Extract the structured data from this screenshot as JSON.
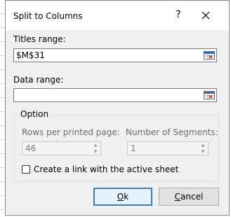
{
  "window": {
    "title": "Split to Columns",
    "help_label": "?"
  },
  "titles_range": {
    "label": "Titles range:",
    "value": "$M$31"
  },
  "data_range": {
    "label": "Data range:",
    "value": ""
  },
  "option": {
    "group_label": "Option",
    "rows_per_page": {
      "label": "Rows per printed page:",
      "value": "46"
    },
    "segments": {
      "label": "Number of Segments:",
      "value": "1"
    },
    "link_checkbox": {
      "label": "Create a link with the active sheet",
      "checked": false
    }
  },
  "buttons": {
    "ok": {
      "accel": "O",
      "rest": "k"
    },
    "cancel": {
      "accel": "C",
      "rest": "ancel"
    }
  },
  "icons": {
    "close": "close-icon",
    "range_select": "range-select-icon",
    "spin_up": "▲",
    "spin_down": "▼"
  },
  "colors": {
    "accent": "#3c7fb1",
    "dialog_bg": "#f0f0f0",
    "disabled_text": "#6d6d6d"
  }
}
